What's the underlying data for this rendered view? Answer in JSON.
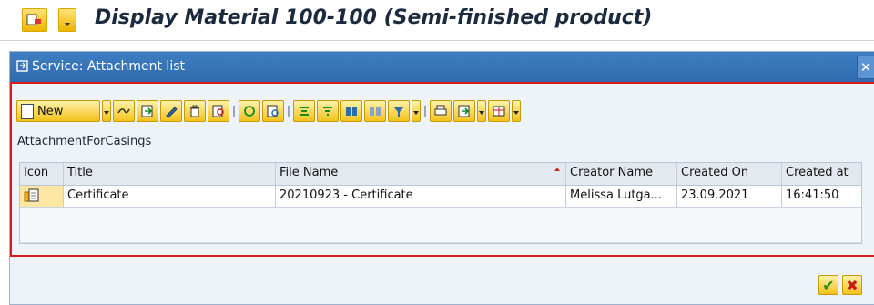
{
  "window": {
    "title": "Display Material 100-100 (Semi-finished product)"
  },
  "dialog": {
    "title": "Service: Attachment list",
    "close_label": "✕"
  },
  "toolbar": {
    "new_label": "New",
    "buttons": [
      "link-icon",
      "export-icon",
      "edit-icon",
      "delete-icon",
      "find-icon",
      "refresh-icon",
      "details-icon",
      "align-icon",
      "filter-icon",
      "binoculars-icon",
      "find-next-icon",
      "filter-funnel-icon",
      "print-icon",
      "export-list-icon",
      "layout-icon"
    ]
  },
  "section": {
    "label": "AttachmentForCasings"
  },
  "table": {
    "headers": [
      "Icon",
      "Title",
      "File Name",
      "Creator Name",
      "Created On",
      "Created at"
    ],
    "sorted_column": "File Name",
    "rows": [
      {
        "icon": "document-icon",
        "title": "Certificate",
        "file_name": "20210923 - Certificate",
        "creator": "Melissa Lutga...",
        "created_on": "23.09.2021",
        "created_at": "16:41:50"
      }
    ]
  },
  "footer": {
    "ok_label": "✔",
    "cancel_label": "✖"
  },
  "colors": {
    "dialog_header": "#2f6aae",
    "button_fill": "#f5c21b",
    "accent_red": "#d81b1b"
  }
}
